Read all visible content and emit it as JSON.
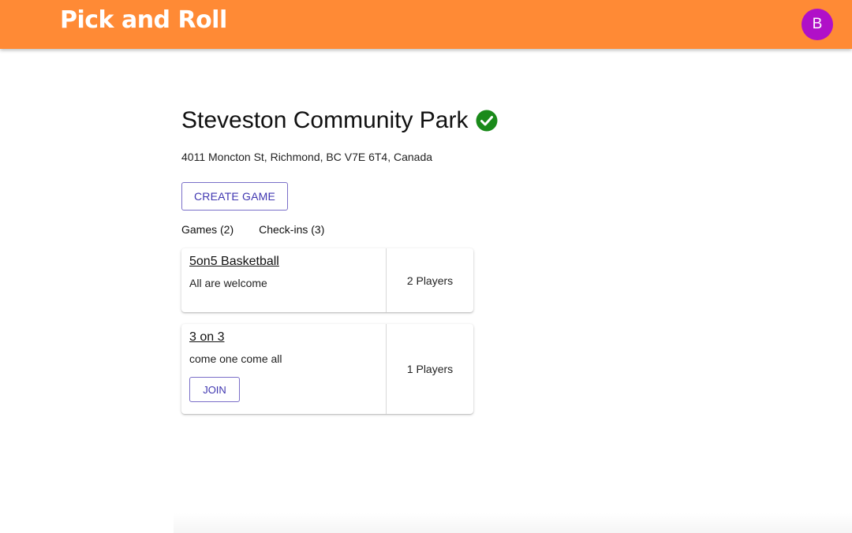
{
  "app": {
    "title": "Pick and Roll",
    "avatar_initial": "B",
    "brand_color": "#ff8a35",
    "avatar_color": "#b010c8"
  },
  "park": {
    "name": "Steveston Community Park",
    "verified_icon": "check-circle-icon",
    "verified_color": "#1a8a1a",
    "address": "4011 Moncton St, Richmond, BC V7E 6T4, Canada"
  },
  "actions": {
    "create_game_label": "CREATE GAME"
  },
  "tabs": [
    {
      "label": "Games (2)"
    },
    {
      "label": "Check-ins (3)"
    }
  ],
  "games": [
    {
      "title": "5on5 Basketball",
      "description": "All are welcome",
      "players": "2 Players"
    },
    {
      "title": "3 on 3",
      "description": "come one come all",
      "join_label": "JOIN",
      "players": "1 Players"
    }
  ]
}
